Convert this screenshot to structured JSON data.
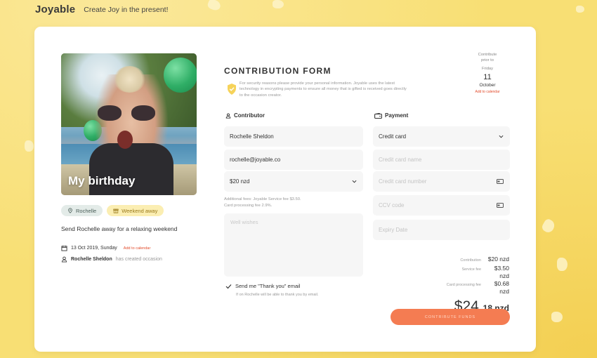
{
  "header": {
    "logo": "Joyable",
    "tagline": "Create Joy in the present!"
  },
  "occasion": {
    "photo_title": "My birthday",
    "recipient_chip": "Rochelle",
    "tag_chip": "Weekend away",
    "description": "Send Rochelle away for a relaxing weekend",
    "date": "13 Oct 2019, Sunday",
    "add_to_calendar": "Add to calendar",
    "creator_name": "Rochelle Sheldon",
    "creator_text": "has created occasion"
  },
  "deadline": {
    "line1": "Contribute",
    "line2": "prior to",
    "weekday": "Friday",
    "day": "11",
    "month": "October",
    "add_to_calendar": "Add to calendar"
  },
  "form": {
    "title": "CONTRIBUTION FORM",
    "security_text": "For security reasons please provide your personal information. Joyable uses the latest technology in encrypting payments to ensure all money that is gifted is received goes directly to the occasion creator.",
    "contributor_label": "Contributor",
    "name_value": "Rochelle Sheldon",
    "email_value": "rochelle@joyable.co",
    "amount_value": "$20 nzd",
    "fee_line1": "Additional fees: Joyable Service fee $3.50.",
    "fee_line2": "Card processing fee 2.9%.",
    "wishes_placeholder": "Well wishes",
    "thanks_label": "Send me \"Thank you\" email",
    "thanks_sub": "If on Rochelle will be able to thank you by email.",
    "payment_label": "Payment",
    "payment_method": "Credit card",
    "card_name_placeholder": "Credit card name",
    "card_number_placeholder": "Credit card number",
    "ccv_placeholder": "CCV code",
    "expiry_placeholder": "Expiry Date"
  },
  "summary": {
    "contribution_label": "Contribution",
    "contribution_value": "$20 nzd",
    "service_label": "Service fee",
    "service_value": "$3.50 nzd",
    "processing_label": "Card processing fee",
    "processing_value": "$0.68 nzd",
    "total_main": "$24.",
    "total_cents": "18 nzd",
    "cta": "CONTRIBUTE FUNDS"
  },
  "colors": {
    "background": "#f8df74",
    "accent": "#f47c52",
    "link": "#e24b2b",
    "chip_tag": "#fbeeb2"
  },
  "icons": [
    "shield-icon",
    "user-icon",
    "wallet-icon",
    "pin-icon",
    "gift-icon",
    "calendar-icon",
    "check-icon",
    "chevron-down-icon",
    "card-icon"
  ]
}
